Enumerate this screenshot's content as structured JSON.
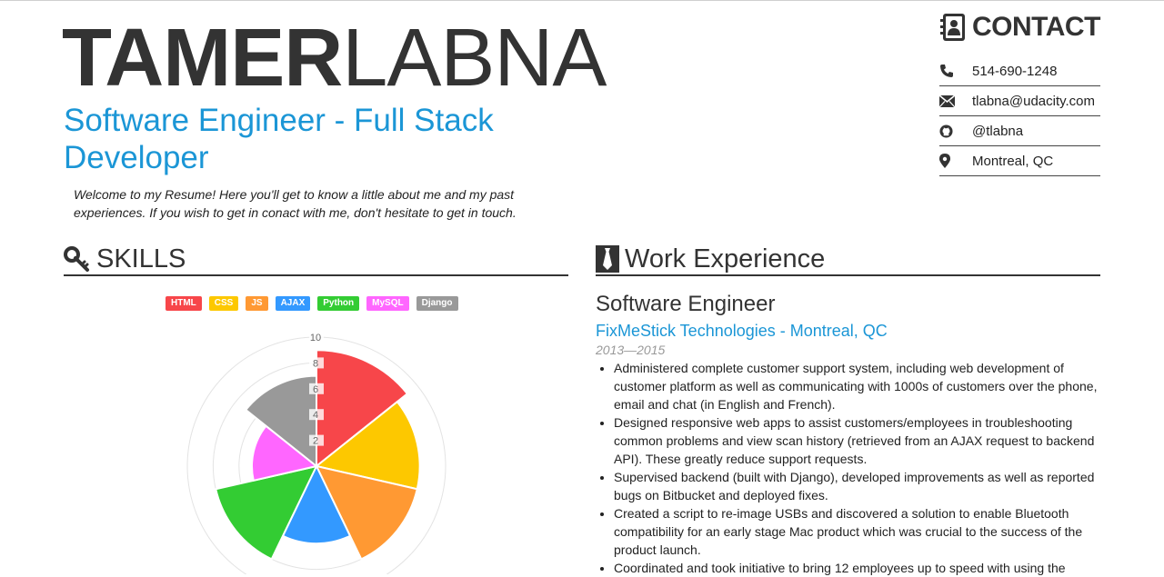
{
  "header": {
    "first_name": "TAMER",
    "last_name": "LABNA",
    "role": "Software Engineer - Full Stack Developer",
    "welcome": "Welcome to my Resume! Here you'll get to know a little about me and my past experiences. If you wish to get in conact with me, don't hesitate to get in touch."
  },
  "contact": {
    "title": "CONTACT",
    "items": [
      {
        "icon": "phone-icon",
        "text": "514-690-1248"
      },
      {
        "icon": "envelope-icon",
        "text": "tlabna@udacity.com"
      },
      {
        "icon": "github-icon",
        "text": "@tlabna"
      },
      {
        "icon": "map-marker-icon",
        "text": "Montreal, QC"
      }
    ]
  },
  "skills": {
    "title": "SKILLS",
    "legend": [
      {
        "label": "HTML",
        "color": "#f7464a"
      },
      {
        "label": "CSS",
        "color": "#fdc800"
      },
      {
        "label": "JS",
        "color": "#ff9933"
      },
      {
        "label": "AJAX",
        "color": "#3399ff"
      },
      {
        "label": "Python",
        "color": "#33cc33"
      },
      {
        "label": "MySQL",
        "color": "#ff66ff"
      },
      {
        "label": "Django",
        "color": "#999999"
      }
    ]
  },
  "chart_data": {
    "type": "polarArea",
    "categories": [
      "HTML",
      "CSS",
      "JS",
      "AJAX",
      "Python",
      "MySQL",
      "Django"
    ],
    "values": [
      9,
      8,
      8,
      6,
      8,
      5,
      7
    ],
    "colors": [
      "#f7464a",
      "#fdc800",
      "#ff9933",
      "#3399ff",
      "#33cc33",
      "#ff66ff",
      "#999999"
    ],
    "ticks": [
      "2",
      "4",
      "6",
      "8",
      "10"
    ],
    "rmax": 10
  },
  "work": {
    "title": "Work Experience",
    "job_title": "Software Engineer",
    "company": "FixMeStick Technologies - Montreal, QC",
    "dates": "2013—2015",
    "bullets": [
      "Administered complete customer support system, including web development of customer platform as well as communicating with 1000s of customers over the phone, email and chat (in English and French).",
      "Designed responsive web apps to assist customers/employees in troubleshooting common problems and view scan history (retrieved from an AJAX request to backend API). These greatly reduce support requests.",
      "Supervised backend (built with Django), developed improvements as well as reported bugs on Bitbucket and deployed fixes.",
      "Created a script to re-image USBs and discovered a solution to enable Bluetooth compatibility for an early stage Mac product which was crucial to the success of the product launch.",
      "Coordinated and took initiative to bring 12 employees up to speed with using the"
    ]
  }
}
